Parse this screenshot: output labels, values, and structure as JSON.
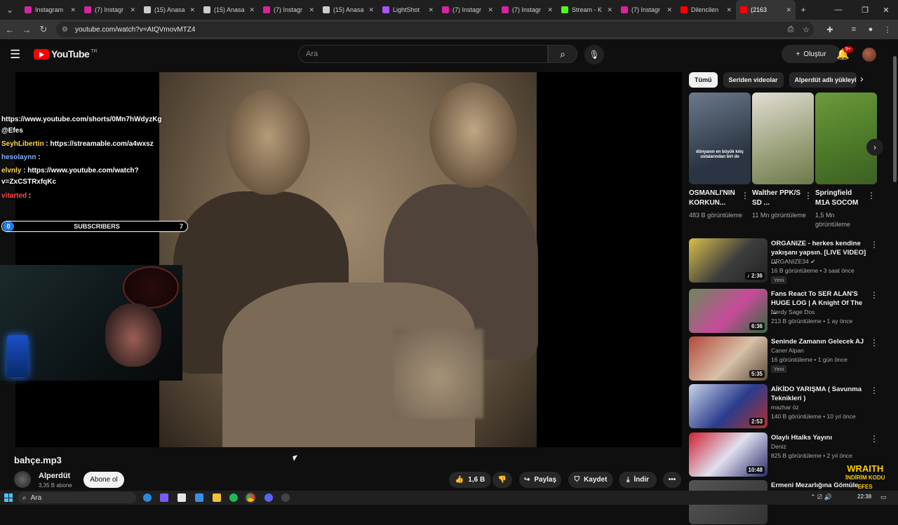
{
  "browser": {
    "tabs": [
      {
        "label": "Instagram",
        "fav_color": "#d6249f"
      },
      {
        "label": "(7) Instagr",
        "fav_color": "#d6249f"
      },
      {
        "label": "(15) Anasa",
        "fav_color": "#cccccc"
      },
      {
        "label": "(15) Anasa",
        "fav_color": "#cccccc"
      },
      {
        "label": "(7) Instagr",
        "fav_color": "#d6249f"
      },
      {
        "label": "(15) Anasa",
        "fav_color": "#cccccc"
      },
      {
        "label": "LightShot",
        "fav_color": "#a855f7"
      },
      {
        "label": "(7) Instagr",
        "fav_color": "#d6249f"
      },
      {
        "label": "(7) Instagr",
        "fav_color": "#d6249f"
      },
      {
        "label": "Stream - K",
        "fav_color": "#53fc18"
      },
      {
        "label": "(7) Instagr",
        "fav_color": "#d6249f"
      },
      {
        "label": "Dilencilen",
        "fav_color": "#ff0000"
      },
      {
        "label": "(2163",
        "fav_color": "#ff0000",
        "active": true
      }
    ],
    "url": "youtube.com/watch?v=AtQVmovMTZ4"
  },
  "youtube": {
    "logo_text": "YouTube",
    "region": "TR",
    "search_placeholder": "Ara",
    "create_label": "Oluştur",
    "notif_badge": "9+"
  },
  "overlay": {
    "links": [
      "https://www.youtube.com/shorts/0Mn7hWdyzKg",
      "@Efes"
    ],
    "chat": [
      {
        "name": "SeyhLibertin",
        "sep": " : ",
        "msg": "https://streamable.com/a4wxsz",
        "color": "yellow"
      },
      {
        "name": "hesolaynn",
        "sep": " : ",
        "msg": "",
        "color": "blue"
      },
      {
        "name": "elvnly",
        "sep": " : ",
        "msg": "https://www.youtube.com/watch?",
        "color": "yellow"
      },
      {
        "name": "",
        "sep": "",
        "msg": "v=ZxCSTRxfqKc",
        "color": "yellow"
      },
      {
        "name": "vitarted",
        "sep": " : ",
        "msg": "",
        "color": "red"
      }
    ],
    "subscribers_label": "SUBSCRIBERS",
    "subscribers_start": "0",
    "subscribers_goal": "7"
  },
  "video": {
    "title": "bahçe.mp3",
    "channel": "Alperdüt",
    "channel_subs": "3,35 B abone",
    "subscribe_label": "Abone ol",
    "likes": "1,6 B",
    "share_label": "Paylaş",
    "save_label": "Kaydet",
    "download_label": "İndir"
  },
  "sidebar": {
    "chips": [
      "Tümü",
      "Seriden videolar",
      "Alperdüt adlı yükleyic"
    ],
    "shorts": [
      {
        "title": "OSMANLI'NIN KORKUN...",
        "views": "483 B görüntüleme",
        "caption": "dünyanın en büyük kılıç ustalarından biri de"
      },
      {
        "title": "Walther PPK/S SD ...",
        "views": "11 Mn görüntüleme"
      },
      {
        "title": "Springfield M1A SOCOM",
        "views": "1,5 Mn görüntüleme"
      }
    ],
    "recs": [
      {
        "title": "ORGANIZE - herkes kendine yakışanı yapsın. [LIVE VIDEO] ...",
        "channel": "ORGANIZE34 ✔",
        "meta": "16 B görüntüleme • 3 saat önce",
        "badge": "Yeni",
        "duration": "♪ 2:36"
      },
      {
        "title": "Fans React To SER ALAN'S HUGE LOG | A Knight Of The ...",
        "channel": "Nerdy Sage Dos",
        "meta": "213 B görüntüleme • 1 ay önce",
        "badge": "",
        "duration": "6:36"
      },
      {
        "title": "Seninde Zamanın Gelecek AJ",
        "channel": "Caner Alpan",
        "meta": "16 görüntüleme • 1 gün önce",
        "badge": "Yeni",
        "duration": "5:35"
      },
      {
        "title": "AİKİDO YARIŞMA ( Savunma Teknikleri )",
        "channel": "mazhar öz",
        "meta": "140 B görüntüleme • 10 yıl önce",
        "badge": "",
        "duration": "2:53"
      },
      {
        "title": "Olaylı Htalks Yayını",
        "channel": "Deniz",
        "meta": "825 B görüntüleme • 2 yıl önce",
        "badge": "",
        "duration": "10:48"
      },
      {
        "title": "Ermeni Mezarlığına Gömüle...",
        "channel": "",
        "meta": "",
        "badge": "",
        "duration": ""
      }
    ]
  },
  "watermark": {
    "line1": "WRAITH",
    "line2": "İNDİRİM KODU",
    "line3": "EFES"
  },
  "taskbar": {
    "search": "Ara",
    "time": "22:38"
  }
}
